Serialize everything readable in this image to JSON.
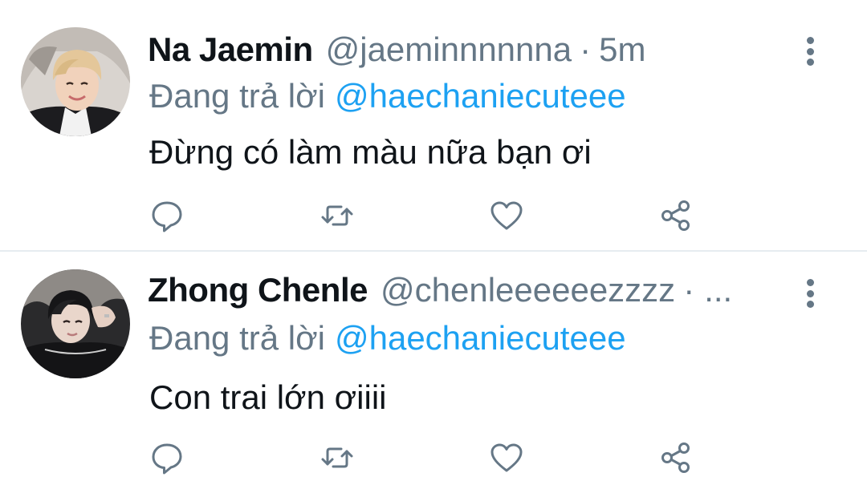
{
  "tweets": [
    {
      "display_name": "Na Jaemin",
      "handle": "@jaeminnnnnna",
      "separator": "·",
      "time": "5m",
      "reply_prefix": "Đang trả lời",
      "reply_to": "@haechaniecuteee",
      "text": "Đừng có làm màu nữa bạn ơi",
      "avatar": "profile-photo-light-hair"
    },
    {
      "display_name": "Zhong Chenle",
      "handle": "@chenleeeeeezzzz",
      "separator": "·",
      "time": "...",
      "reply_prefix": "Đang trả lời",
      "reply_to": "@haechaniecuteee",
      "text": "Con trai lớn ơiiii",
      "avatar": "profile-photo-dark"
    }
  ],
  "icons": {
    "more": "more-vertical-icon",
    "reply": "reply-bubble-icon",
    "retweet": "retweet-icon",
    "like": "heart-icon",
    "share": "share-icon"
  },
  "colors": {
    "text_primary": "#0f1419",
    "text_secondary": "#657786",
    "link": "#1da1f2",
    "divider": "#e6ecf0"
  }
}
